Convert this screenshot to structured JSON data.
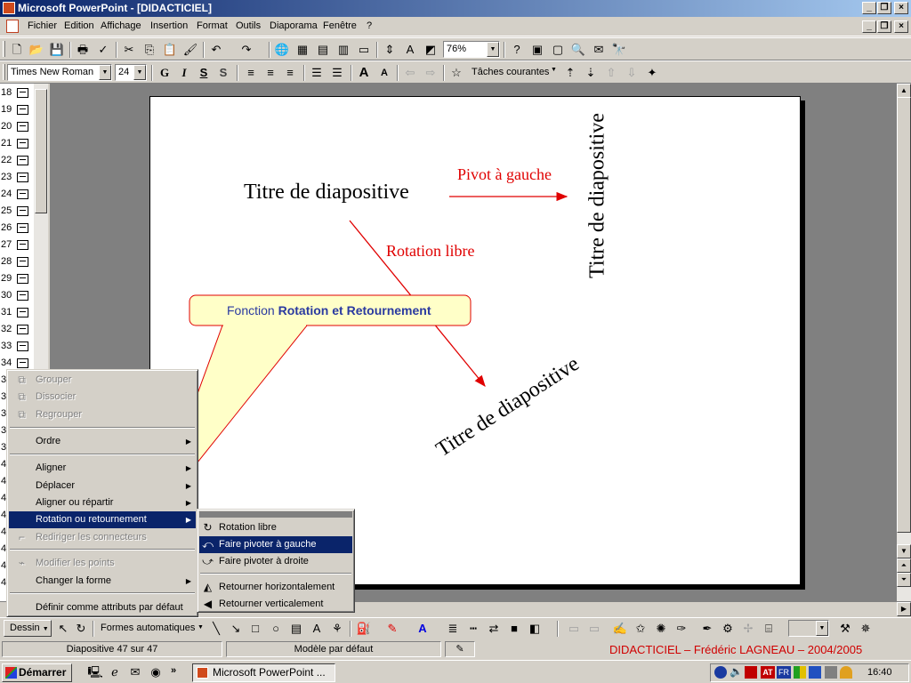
{
  "window": {
    "title": "Microsoft PowerPoint - [DIDACTICIEL]",
    "minimize": "_",
    "maximize": "❐",
    "close": "×"
  },
  "menubar": [
    "Fichier",
    "Edition",
    "Affichage",
    "Insertion",
    "Format",
    "Outils",
    "Diaporama",
    "Fenêtre",
    "?"
  ],
  "standard_toolbar": {
    "zoom": "76%"
  },
  "format_toolbar": {
    "font": "Times New Roman",
    "size": "24",
    "bold": "G",
    "italic": "I",
    "underline": "S",
    "shadow": "S",
    "tasks": "Tâches courantes"
  },
  "outline_numbers": [
    "18",
    "19",
    "20",
    "21",
    "22",
    "23",
    "24",
    "25",
    "26",
    "27",
    "28",
    "29",
    "30",
    "31",
    "32",
    "33",
    "34",
    "35",
    "36",
    "37",
    "38",
    "39",
    "40",
    "41",
    "42",
    "43",
    "44",
    "45",
    "46",
    "47"
  ],
  "slide": {
    "title_normal": "Titre de diapositive",
    "label_pivot": "Pivot à gauche",
    "title_rotated_left": "Titre de diapositive",
    "label_free": "Rotation libre",
    "title_free": "Titre de diapositive",
    "callout_prefix": "Fonction ",
    "callout_bold": "Rotation et Retournement"
  },
  "context_menu": {
    "group": "Grouper",
    "ungroup": "Dissocier",
    "regroup": "Regrouper",
    "order": "Ordre",
    "grid": "Aligner",
    "nudge": "Déplacer",
    "align": "Aligner ou répartir",
    "rotate": "Rotation ou retournement",
    "reroute": "Rediriger les connecteurs",
    "edit_points": "Modifier les points",
    "change_shape": "Changer la forme",
    "set_default": "Définir comme attributs par défaut"
  },
  "submenu": {
    "free_rotate": "Rotation libre",
    "rotate_left": "Faire pivoter à gauche",
    "rotate_right": "Faire pivoter à droite",
    "flip_h": "Retourner horizontalement",
    "flip_v": "Retourner verticalement"
  },
  "drawing_toolbar": {
    "draw": "Dessin",
    "autoshapes": "Formes automatiques"
  },
  "statusbar": {
    "slide": "Diapositive 47 sur 47",
    "design": "Modèle par défaut",
    "credit": "DIDACTICIEL – Frédéric LAGNEAU – 2004/2005"
  },
  "taskbar": {
    "start": "Démarrer",
    "more": "»",
    "task": "Microsoft PowerPoint ...",
    "time": "16:40",
    "lang": "FR"
  },
  "colors": {
    "title_bar": "#0a246a",
    "menu_highlight": "#0a246a",
    "annotation_red": "#e00000",
    "callout_fill": "#ffffc8",
    "callout_text": "#2a3aa0",
    "credit_red": "#d00000"
  }
}
